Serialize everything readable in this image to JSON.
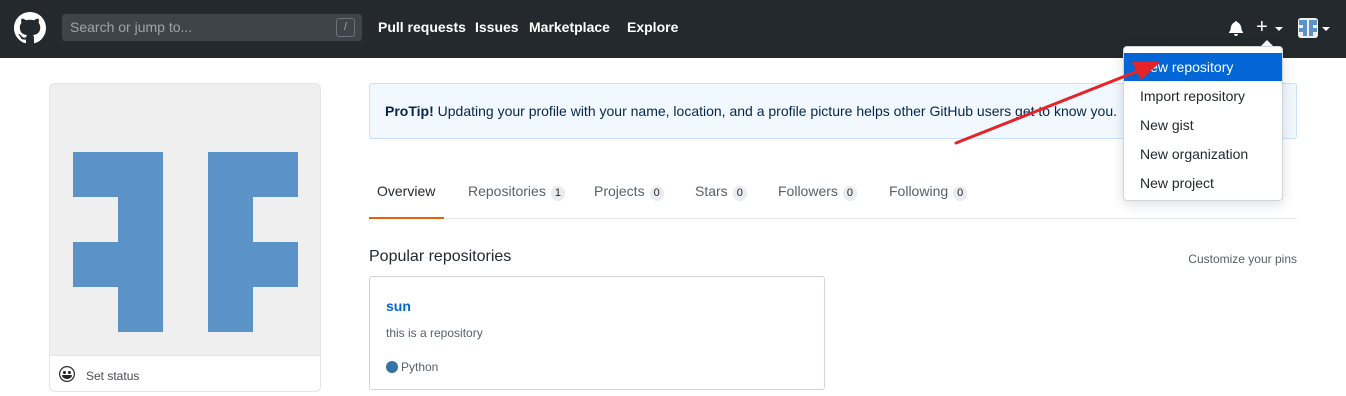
{
  "header": {
    "logo_icon": "github-octocat-icon",
    "search_placeholder": "Search or jump to...",
    "search_shortcut": "/",
    "nav": [
      "Pull requests",
      "Issues",
      "Marketplace",
      "Explore"
    ],
    "bell_icon": "bell-icon",
    "plus_icon": "plus-icon",
    "plus_label": "+"
  },
  "dropdown": {
    "items": [
      "New repository",
      "Import repository",
      "New gist",
      "New organization",
      "New project"
    ],
    "active_index": 0
  },
  "sidebar": {
    "set_status_label": "Set status",
    "smiley_icon": "smiley-icon"
  },
  "protip": {
    "strong": "ProTip!",
    "text": " Updating your profile with your name, location, and a profile picture helps other GitHub users get to know you."
  },
  "tabs": [
    {
      "label": "Overview",
      "count": ""
    },
    {
      "label": "Repositories",
      "count": "1"
    },
    {
      "label": "Projects",
      "count": "0"
    },
    {
      "label": "Stars",
      "count": "0"
    },
    {
      "label": "Followers",
      "count": "0"
    },
    {
      "label": "Following",
      "count": "0"
    }
  ],
  "popular": {
    "title": "Popular repositories",
    "customize": "Customize your pins",
    "repo": {
      "name": "sun",
      "description": "this is a repository",
      "language": "Python",
      "language_color": "#3572A5"
    }
  },
  "colors": {
    "header_bg": "#24292e",
    "accent_blue": "#0366d6",
    "tab_active_underline": "#e36209",
    "identicon": "#5b93c8",
    "annotation_arrow": "#e5242a"
  }
}
